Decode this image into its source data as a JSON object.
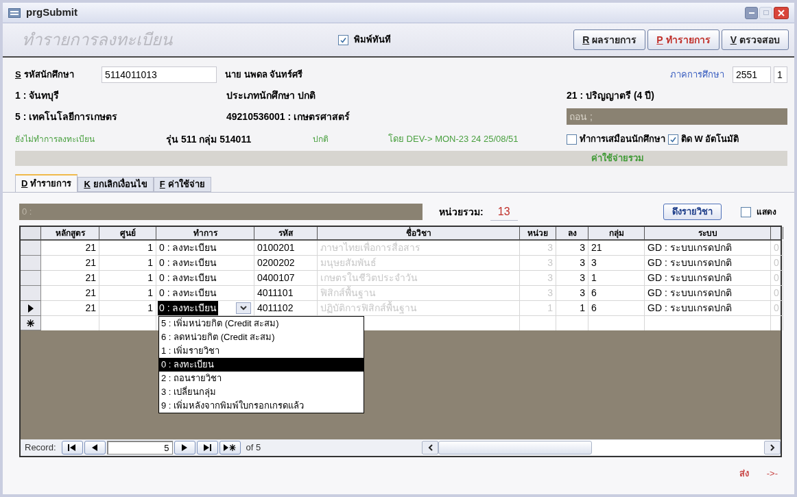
{
  "window": {
    "title": "prgSubmit"
  },
  "header": {
    "title": "ทำรายการลงทะเบียน",
    "print_now": {
      "label": "พิมพ์ทันที",
      "checked": true
    },
    "buttons": [
      {
        "key": "R",
        "label": "ผลรายการ",
        "highlighted": false
      },
      {
        "key": "P",
        "label": "ทำรายการ",
        "highlighted": true
      },
      {
        "key": "V",
        "label": "ตรวจสอบ",
        "highlighted": false
      }
    ]
  },
  "student": {
    "id_label_key": "S",
    "id_label": "รหัสนักศึกษา",
    "id_value": "5114011013",
    "name": "นาย นพดล จันทร์ศรี",
    "term_label": "ภาคการศึกษา",
    "year": "2551",
    "term": "1",
    "campus": "1 : จันทบุรี",
    "student_type": "ประเภทนักศึกษา ปกติ",
    "level": "21 : ปริญญาตรี (4 ปี)",
    "faculty": "5 : เทคโนโลยีการเกษตร",
    "program": "49210536001 : เกษตรศาสตร์",
    "withdraw_note": "ถอน ;",
    "status": "ยังไม่ทำการลงทะเบียน",
    "cohort": "รุ่น 511 กลุ่ม 514011",
    "regular": "ปกติ",
    "by": "โดย DEV-> MON-23 24 25/08/51",
    "options": [
      {
        "label": "ทำการเสมือนนักศึกษา",
        "checked": false
      },
      {
        "label": "ติด W อัตโนมัติ",
        "checked": true
      }
    ],
    "total_cost_label": "ค่าใช้จ่ายรวม"
  },
  "tabs": [
    {
      "key": "D",
      "label": "ทำรายการ",
      "selected": true
    },
    {
      "key": "K",
      "label": "ยกเลิกเงื่อนไข",
      "selected": false
    },
    {
      "key": "F",
      "label": "ค่าใช้จ่าย",
      "selected": false
    }
  ],
  "panel": {
    "bar_text": "0 :",
    "total_units_label": "หน่วยรวม:",
    "total_units": "13",
    "fetch_button": "ดึงรายวิชา",
    "show": {
      "label": "แสดง",
      "checked": false
    }
  },
  "table": {
    "columns": [
      "หลักสูตร",
      "ศูนย์",
      "ทำการ",
      "รหัส",
      "ชื่อวิชา",
      "หน่วย",
      "ลง",
      "กลุ่ม",
      "ระบบ"
    ],
    "rows": [
      {
        "current": false,
        "cells": [
          "21",
          "1",
          "0 : ลงทะเบียน",
          "0100201",
          "ภาษาไทยเพื่อการสื่อสาร",
          "3",
          "3",
          "21",
          "GD : ระบบเกรดปกติ",
          "0"
        ]
      },
      {
        "current": false,
        "cells": [
          "21",
          "1",
          "0 : ลงทะเบียน",
          "0200202",
          "มนุษยสัมพันธ์",
          "3",
          "3",
          "3",
          "GD : ระบบเกรดปกติ",
          "0"
        ]
      },
      {
        "current": false,
        "cells": [
          "21",
          "1",
          "0 : ลงทะเบียน",
          "0400107",
          "เกษตรในชีวิตประจำวัน",
          "3",
          "3",
          "1",
          "GD : ระบบเกรดปกติ",
          "0"
        ]
      },
      {
        "current": false,
        "cells": [
          "21",
          "1",
          "0 : ลงทะเบียน",
          "4011101",
          "ฟิสิกส์พื้นฐาน",
          "3",
          "3",
          "6",
          "GD : ระบบเกรดปกติ",
          "0"
        ]
      },
      {
        "current": true,
        "cells": [
          "21",
          "1",
          "0 : ลงทะเบียน",
          "4011102",
          "ปฏิบัติการฟิสิกส์พื้นฐาน",
          "1",
          "1",
          "6",
          "GD : ระบบเกรดปกติ",
          "0"
        ]
      }
    ],
    "dropdown": [
      {
        "label": "5 : เพิ่มหน่วยกิต (Credit สะสม)",
        "selected": false
      },
      {
        "label": "6 : ลดหน่วยกิต (Credit สะสม)",
        "selected": false
      },
      {
        "label": "1 : เพิ่มรายวิชา",
        "selected": false
      },
      {
        "label": "0 : ลงทะเบียน",
        "selected": true
      },
      {
        "label": "2 : ถอนรายวิชา",
        "selected": false
      },
      {
        "label": "3 : เปลี่ยนกลุ่ม",
        "selected": false
      },
      {
        "label": "9 : เพิ่มหลังจากพิมพ์ใบกรอกเกรดแล้ว",
        "selected": false
      }
    ],
    "navigator": {
      "label": "Record:",
      "current": "5",
      "of": "of 5"
    }
  },
  "footer": {
    "send": "ส่ง",
    "arrow": "->-"
  }
}
